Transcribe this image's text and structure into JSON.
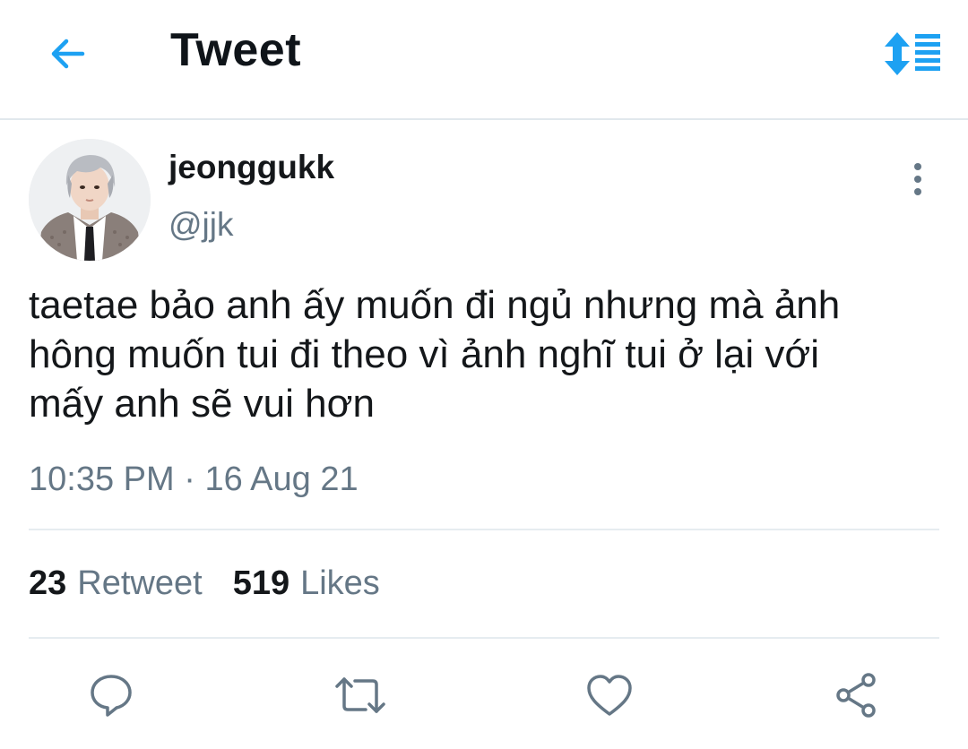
{
  "header": {
    "title": "Tweet",
    "back_icon": "arrow-left-icon",
    "sort_icon": "sort-arrows-icon",
    "accent_color": "#1da1f2"
  },
  "tweet": {
    "display_name": "jeonggukk",
    "handle": "@jjk",
    "text": "taetae bảo anh ấy muốn đi ngủ nhưng mà ảnh\nhông muốn tui đi theo vì ảnh nghĩ tui ở lại với\nmấy anh sẽ vui hơn",
    "time": "10:35 PM",
    "separator": "·",
    "date": "16 Aug 21",
    "more_icon": "more-vertical-icon"
  },
  "stats": {
    "retweets_count": "23",
    "retweets_label": "Retweet",
    "likes_count": "519",
    "likes_label": "Likes"
  },
  "actions": {
    "reply_icon": "reply-icon",
    "retweet_icon": "retweet-icon",
    "like_icon": "heart-icon",
    "share_icon": "share-icon"
  },
  "colors": {
    "text_primary": "#14171a",
    "text_secondary": "#657786",
    "divider": "#e6ecf0"
  }
}
